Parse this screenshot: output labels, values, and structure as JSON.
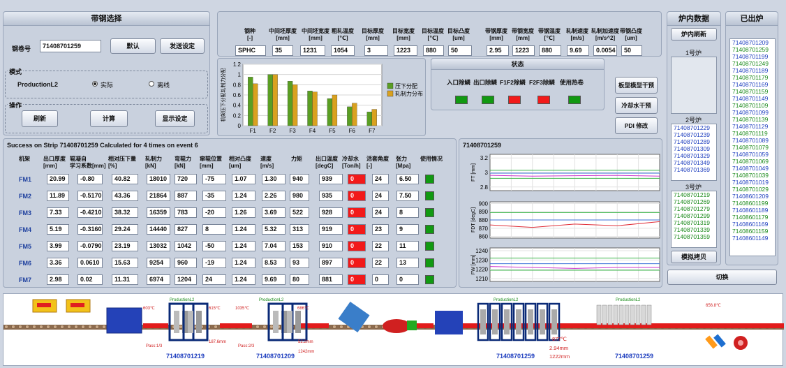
{
  "strip_select": {
    "title": "带钢选择",
    "coil_label": "钢卷号",
    "coil_value": "71408701259",
    "default_btn": "默认",
    "send_btn": "发送设定",
    "mode_title": "模式",
    "mode_name": "ProductionL2",
    "mode_actual": "实际",
    "mode_offline": "离线",
    "op_title": "操作",
    "refresh_btn": "刷新",
    "calc_btn": "计算",
    "show_btn": "显示设定"
  },
  "params": {
    "headers": [
      {
        "l1": "钢种",
        "l2": "[-]"
      },
      {
        "l1": "中间坯厚度",
        "l2": "[mm]"
      },
      {
        "l1": "中间坯宽度",
        "l2": "[mm]"
      },
      {
        "l1": "粗轧温度",
        "l2": "[℃]"
      },
      {
        "l1": "目标厚度",
        "l2": "[mm]"
      },
      {
        "l1": "目标宽度",
        "l2": "[mm]"
      },
      {
        "l1": "目标温度",
        "l2": "[℃]"
      },
      {
        "l1": "目标凸度",
        "l2": "[um]"
      },
      {
        "l1": "带钢厚度",
        "l2": "[mm]"
      },
      {
        "l1": "带钢宽度",
        "l2": "[mm]"
      },
      {
        "l1": "带钢温度",
        "l2": "[℃]"
      },
      {
        "l1": "轧制速度",
        "l2": "[m/s]"
      },
      {
        "l1": "轧制加速度",
        "l2": "[m/s^2]"
      },
      {
        "l1": "带钢凸度",
        "l2": "[um]"
      }
    ],
    "values": [
      "SPHC",
      "35",
      "1231",
      "1054",
      "3",
      "1223",
      "880",
      "50",
      "2.95",
      "1223",
      "880",
      "9.69",
      "0.0054",
      "50"
    ]
  },
  "dist_chart": {
    "ylabel": "机架压下分配轧制力分配",
    "legend": [
      "压下分配",
      "轧制力分布"
    ],
    "colors": [
      "#5a9e23",
      "#d9a11f"
    ],
    "chart_data": {
      "type": "bar",
      "categories": [
        "F1",
        "F2",
        "F3",
        "F4",
        "F5",
        "F6",
        "F7"
      ],
      "series": [
        {
          "name": "压下分配",
          "values": [
            0.95,
            1.0,
            0.87,
            0.68,
            0.53,
            0.37,
            0.27
          ]
        },
        {
          "name": "轧制力分布",
          "values": [
            0.82,
            1.0,
            0.8,
            0.66,
            0.6,
            0.44,
            0.32
          ]
        }
      ],
      "ylim": [
        0,
        1.2
      ],
      "yticks": [
        "0",
        "0.2",
        "0.4",
        "0.6",
        "0.8",
        "1",
        "1.2"
      ]
    }
  },
  "status": {
    "title": "状态",
    "items": [
      {
        "label": "入口除鳞",
        "state": "green"
      },
      {
        "label": "出口除鳞",
        "state": "green"
      },
      {
        "label": "F1F2除鳞",
        "state": "red"
      },
      {
        "label": "F2F3除鳞",
        "state": "red"
      },
      {
        "label": "使用热卷",
        "state": "green"
      }
    ]
  },
  "side_buttons": {
    "a": "板型模型干预",
    "b": "冷却水干预",
    "c": "PDI 修改"
  },
  "calc": {
    "title": "Success on Strip 71408701259 Calculated for 4 times on event 6",
    "headers": [
      {
        "l1": "机架",
        "l2": ""
      },
      {
        "l1": "出口厚度",
        "l2": "[mm]"
      },
      {
        "l1": "辊凝自",
        "l2": "学习系数[mm]"
      },
      {
        "l1": "相对压下量",
        "l2": "[%]"
      },
      {
        "l1": "轧制力",
        "l2": "[kN]"
      },
      {
        "l1": "弯辊力",
        "l2": "[kN]"
      },
      {
        "l1": "窜辊位置",
        "l2": "[mm]"
      },
      {
        "l1": "相对凸度",
        "l2": "[um]"
      },
      {
        "l1": "速度",
        "l2": "[m/s]"
      },
      {
        "l1": "力矩",
        "l2": ""
      },
      {
        "l1": "出口温度",
        "l2": "[degC]"
      },
      {
        "l1": "冷却水",
        "l2": "[Ton/h]"
      },
      {
        "l1": "活套角度",
        "l2": "[-]"
      },
      {
        "l1": "张力",
        "l2": "[Mpa]"
      },
      {
        "l1": "使用情况",
        "l2": ""
      }
    ],
    "rows": [
      {
        "name": "FM1",
        "v": [
          "20.99",
          "-0.80",
          "40.82",
          "18010",
          "720",
          "-75",
          "1.07",
          "1.30",
          "940",
          "939",
          "0",
          "24",
          "6.50"
        ]
      },
      {
        "name": "FM2",
        "v": [
          "11.89",
          "-0.5170",
          "43.36",
          "21864",
          "887",
          "-35",
          "1.24",
          "2.26",
          "980",
          "935",
          "0",
          "24",
          "7.50"
        ]
      },
      {
        "name": "FM3",
        "v": [
          "7.33",
          "-0.4210",
          "38.32",
          "16359",
          "783",
          "-20",
          "1.26",
          "3.69",
          "522",
          "928",
          "0",
          "24",
          "8"
        ]
      },
      {
        "name": "FM4",
        "v": [
          "5.19",
          "-0.3160",
          "29.24",
          "14440",
          "827",
          "8",
          "1.24",
          "5.32",
          "313",
          "919",
          "0",
          "23",
          "9"
        ]
      },
      {
        "name": "FM5",
        "v": [
          "3.99",
          "-0.0790",
          "23.19",
          "13032",
          "1042",
          "-50",
          "1.24",
          "7.04",
          "153",
          "910",
          "0",
          "22",
          "11"
        ]
      },
      {
        "name": "FM6",
        "v": [
          "3.36",
          "0.0610",
          "15.63",
          "9254",
          "960",
          "-19",
          "1.24",
          "8.53",
          "93",
          "897",
          "0",
          "22",
          "13"
        ]
      },
      {
        "name": "FM7",
        "v": [
          "2.98",
          "0.02",
          "11.31",
          "6974",
          "1204",
          "24",
          "1.24",
          "9.69",
          "80",
          "881",
          "0",
          "0",
          "0"
        ]
      }
    ]
  },
  "trend": {
    "title": "71408701259",
    "charts": [
      {
        "ylabel": "FT [mm]",
        "ticks": [
          "3.2",
          "3",
          "2.8"
        ],
        "ymin": 2.75,
        "ymax": 3.25
      },
      {
        "ylabel": "FDT [degC]",
        "ticks": [
          "900",
          "890",
          "880",
          "870",
          "860"
        ],
        "ymin": 858,
        "ymax": 902
      },
      {
        "ylabel": "FW [mm]",
        "ticks": [
          "1240",
          "1230",
          "1220",
          "1210"
        ],
        "ymin": 1207,
        "ymax": 1243
      }
    ]
  },
  "furnace": {
    "title": "炉内数据",
    "refresh_btn": "炉内刷新",
    "f1_label": "1号炉",
    "f2_label": "2号炉",
    "f2_items": [
      "71408701229",
      "71408701239",
      "71408701289",
      "71408701309",
      "71408701329",
      "71408701349",
      "71408701369"
    ],
    "f3_label": "3号炉",
    "f3_items": [
      "71408701219",
      "71408701269",
      "71408701279",
      "71408701299",
      "71408701319",
      "71408701339",
      "71408701359"
    ],
    "copy_btn": "模拟拷贝",
    "switch_btn": "切换"
  },
  "exited": {
    "title": "已出炉",
    "items": [
      {
        "id": "71408701209",
        "c": "blue"
      },
      {
        "id": "71408701259",
        "c": "grn"
      },
      {
        "id": "71408701199",
        "c": "blue"
      },
      {
        "id": "71408701249",
        "c": "grn"
      },
      {
        "id": "71408701189",
        "c": "blue"
      },
      {
        "id": "71408701179",
        "c": "grn"
      },
      {
        "id": "71408701169",
        "c": "blue"
      },
      {
        "id": "71408701159",
        "c": "grn"
      },
      {
        "id": "71408701149",
        "c": "blue"
      },
      {
        "id": "71408701109",
        "c": "grn"
      },
      {
        "id": "71408701099",
        "c": "blue"
      },
      {
        "id": "71408701139",
        "c": "grn"
      },
      {
        "id": "71408701129",
        "c": "blue"
      },
      {
        "id": "71408701119",
        "c": "grn"
      },
      {
        "id": "71408701089",
        "c": "blue"
      },
      {
        "id": "71408701079",
        "c": "grn"
      },
      {
        "id": "71408701059",
        "c": "blue"
      },
      {
        "id": "71408701069",
        "c": "grn"
      },
      {
        "id": "71408701049",
        "c": "blue"
      },
      {
        "id": "71408701039",
        "c": "grn"
      },
      {
        "id": "71408701019",
        "c": "blue"
      },
      {
        "id": "71408701029",
        "c": "grn"
      },
      {
        "id": "71408601209",
        "c": "blue"
      },
      {
        "id": "71408601199",
        "c": "grn"
      },
      {
        "id": "71408601189",
        "c": "blue"
      },
      {
        "id": "71408601179",
        "c": "grn"
      },
      {
        "id": "71408601169",
        "c": "blue"
      },
      {
        "id": "71408601159",
        "c": "grn"
      },
      {
        "id": "71408601149",
        "c": "blue"
      }
    ]
  },
  "line": {
    "strip_ids": [
      "71408701219",
      "71408701209",
      "71408701259",
      "71408701259"
    ],
    "prod_labels": [
      "ProductionL2",
      "ProductionL2",
      "ProductionL2",
      "ProductionL2"
    ],
    "temps": [
      "603℃",
      "615℃",
      "1035℃",
      "686℃",
      "656.8℃"
    ],
    "notes": [
      "187.6mm",
      "Pass:1/3",
      "Pass:2/3",
      "52.2mm",
      "1242mm"
    ],
    "exit_info": [
      "877℃",
      "2.94mm",
      "1222mm"
    ]
  }
}
